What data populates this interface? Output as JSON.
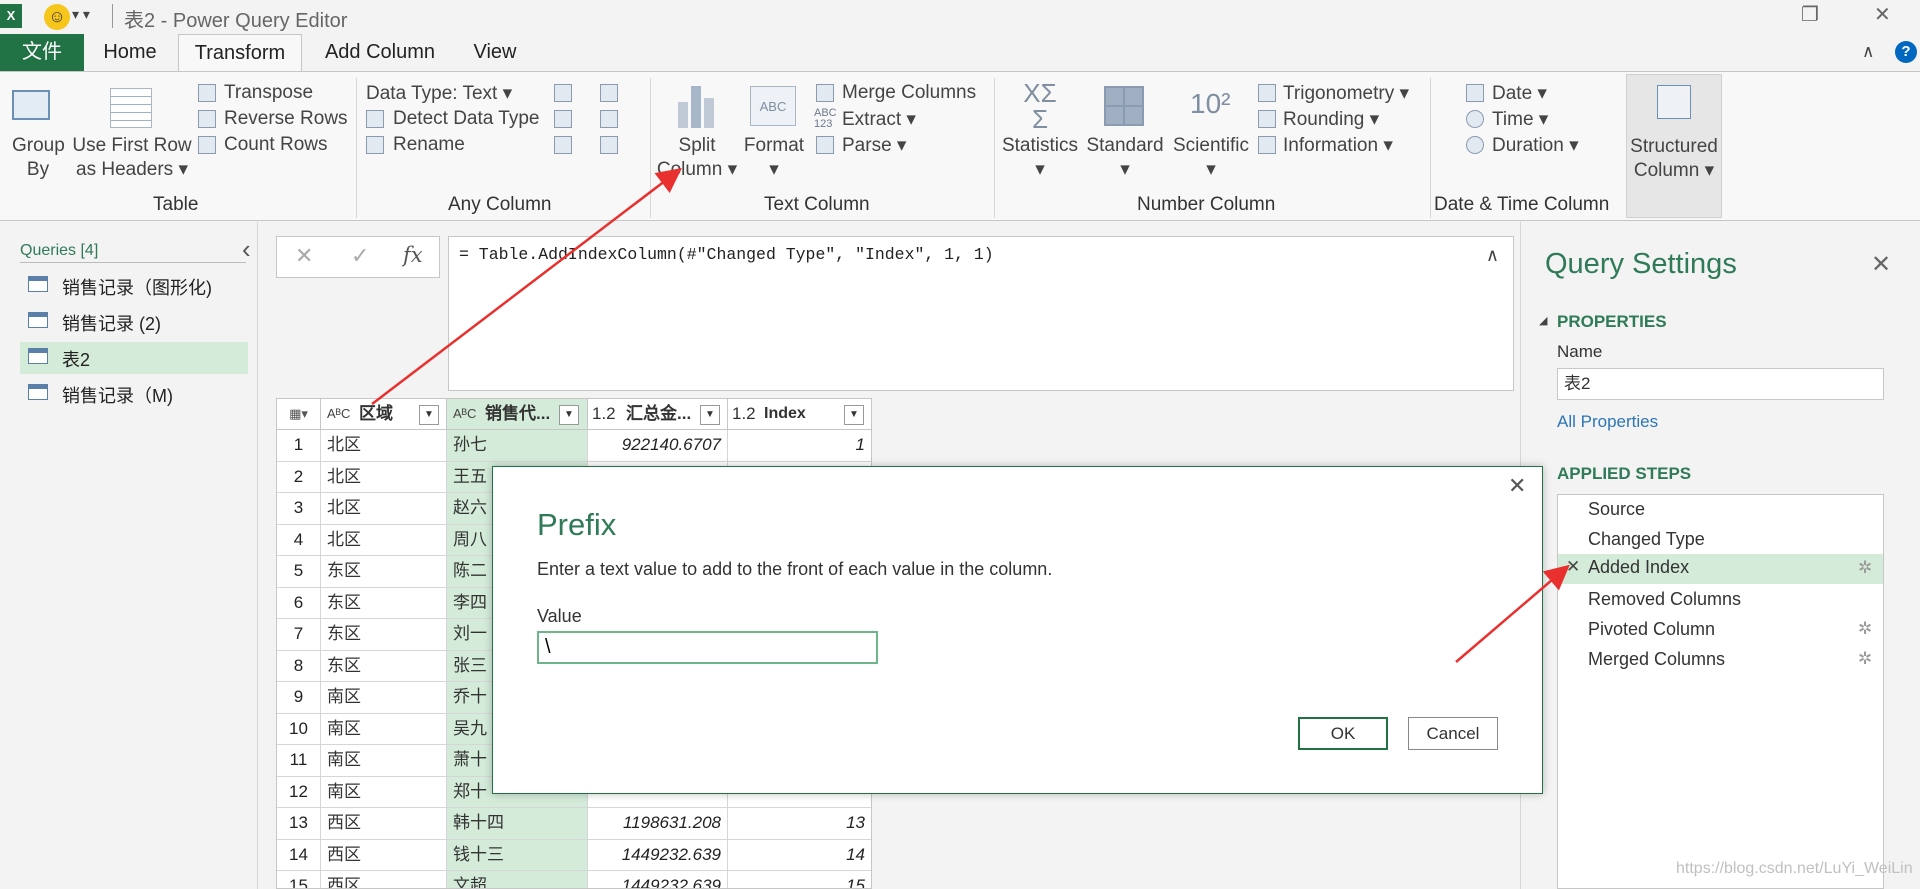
{
  "titlebar": {
    "app_icon": "X",
    "window_title": "表2 - Power Query Editor",
    "smiley": "☺",
    "quick_access": "▾ ▾",
    "restore_glyph": "❐",
    "close_glyph": "✕"
  },
  "tabs": [
    "文件",
    "Home",
    "Transform",
    "Add Column",
    "View"
  ],
  "ribbon": {
    "collapse_glyph": "∧",
    "help_glyph": "?",
    "table": {
      "group_by": [
        "Group",
        "By"
      ],
      "use_first_row": [
        "Use First Row",
        "as Headers ▾"
      ],
      "transpose": "Transpose",
      "reverse_rows": "Reverse Rows",
      "count_rows": "Count Rows",
      "label": "Table"
    },
    "any_column": {
      "data_type": "Data Type: Text ▾",
      "detect": "Detect Data Type",
      "rename": "Rename",
      "label": "Any Column"
    },
    "text_column": {
      "split": [
        "Split",
        "Column ▾"
      ],
      "format": [
        "Format",
        "▾"
      ],
      "merge": "Merge Columns",
      "extract": "Extract ▾",
      "parse": "Parse ▾",
      "abc_icon": "ABC",
      "abc123_icon": "ABC 123",
      "label": "Text Column"
    },
    "number_column": {
      "statistics": [
        "Statistics",
        "▾"
      ],
      "standard": [
        "Standard",
        "▾"
      ],
      "scientific": [
        "Scientific",
        "▾"
      ],
      "trig": "Trigonometry ▾",
      "rounding": "Rounding ▾",
      "information": "Information ▾",
      "label": "Number Column"
    },
    "datetime": {
      "date": "Date ▾",
      "time": "Time ▾",
      "duration": "Duration ▾",
      "label": "Date & Time Column"
    },
    "structured": [
      "Structured",
      "Column ▾"
    ]
  },
  "queries": {
    "header": "Queries [4]",
    "collapse": "‹",
    "items": [
      "销售记录（图形化)",
      "销售记录 (2)",
      "表2",
      "销售记录（M)"
    ]
  },
  "formula": {
    "cancel": "✕",
    "confirm": "✓",
    "fx": "fx",
    "text": "= Table.AddIndexColumn(#\"Changed Type\", \"Index\", 1, 1)",
    "expand": "∧"
  },
  "grid": {
    "corner_icon": "▦▾",
    "columns": [
      {
        "type": "AᴮC",
        "name": "区域"
      },
      {
        "type": "AᴮC",
        "name": "销售代..."
      },
      {
        "type": "1.2",
        "name": "汇总金..."
      },
      {
        "type": "1.2",
        "name": "Index"
      }
    ],
    "dropdown_glyph": "▼",
    "rows": [
      [
        "1",
        "北区",
        "孙七",
        "922140.6707",
        "1"
      ],
      [
        "2",
        "北区",
        "王五",
        "",
        ""
      ],
      [
        "3",
        "北区",
        "赵六",
        "",
        ""
      ],
      [
        "4",
        "北区",
        "周八",
        "",
        ""
      ],
      [
        "5",
        "东区",
        "陈二",
        "",
        ""
      ],
      [
        "6",
        "东区",
        "李四",
        "",
        ""
      ],
      [
        "7",
        "东区",
        "刘一",
        "",
        ""
      ],
      [
        "8",
        "东区",
        "张三",
        "",
        ""
      ],
      [
        "9",
        "南区",
        "乔十",
        "",
        ""
      ],
      [
        "10",
        "南区",
        "吴九",
        "",
        ""
      ],
      [
        "11",
        "南区",
        "萧十",
        "",
        ""
      ],
      [
        "12",
        "南区",
        "郑十",
        "",
        ""
      ],
      [
        "13",
        "西区",
        "韩十四",
        "1198631.208",
        "13"
      ],
      [
        "14",
        "西区",
        "钱十三",
        "1449232.639",
        "14"
      ],
      [
        "15",
        "西区",
        "文超",
        "1449232.639",
        "15"
      ]
    ]
  },
  "query_settings": {
    "title": "Query Settings",
    "close": "✕",
    "properties": "PROPERTIES",
    "name_label": "Name",
    "name_value": "表2",
    "all_properties": "All Properties",
    "applied_steps": "APPLIED STEPS",
    "steps": [
      "Source",
      "Changed Type",
      "Added Index",
      "Removed Columns",
      "Pivoted Column",
      "Merged Columns"
    ],
    "delete_glyph": "✕",
    "gear_glyph": "✲"
  },
  "dialog": {
    "title": "Prefix",
    "description": "Enter a text value to add to the front of each value in the column.",
    "value_label": "Value",
    "value": "\\",
    "ok": "OK",
    "cancel": "Cancel",
    "close": "✕"
  },
  "watermark": "https://blog.csdn.net/LuYi_WeiLin",
  "colors": {
    "accent": "#217346",
    "selection": "#d4ebd9",
    "arrow": "#e8312f"
  }
}
